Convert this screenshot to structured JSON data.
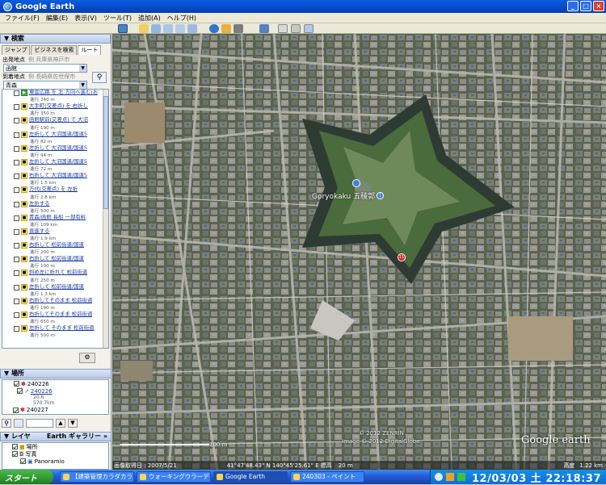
{
  "window": {
    "title": "Google Earth"
  },
  "menu": [
    "ファイル(F)",
    "編集(E)",
    "表示(V)",
    "ツール(T)",
    "追加(A)",
    "ヘルプ(H)"
  ],
  "search_panel": {
    "header": "▼ 検索",
    "tabs": [
      "ジャンプ",
      "ビジネスを検索",
      "ルート"
    ],
    "from_label": "出発地点",
    "from_example": "例  兵庫県神戸市",
    "from_value": "函館",
    "to_label": "到着地点",
    "to_example": "例  長崎県佐世保市",
    "to_value": "青森"
  },
  "route_steps": [
    {
      "text": "東雲広路 を 北 方向へ進む(お",
      "sub": "進行 240 m",
      "start": true
    },
    {
      "text": "大手町(交差点) を 右折し",
      "sub": "進行 350 m"
    },
    {
      "text": "函館駅前(交差点) で 大沼",
      "sub": "進行 190 m"
    },
    {
      "text": "左折して 大沼国道/国道5",
      "sub": "進行 82 m"
    },
    {
      "text": "左折して 大沼国道/国道5",
      "sub": "進行 94 m"
    },
    {
      "text": "左折して 大沼国道/国道5",
      "sub": "進行 72 m"
    },
    {
      "text": "右折して 大沼国道/国道5",
      "sub": "進行 1.5 km"
    },
    {
      "text": "万代(交差点) を 左折",
      "sub": "進行 2.8 km"
    },
    {
      "text": "左折する",
      "sub": "進行 500 m"
    },
    {
      "text": "青森/函館 長船 一部有料",
      "sub": "進行 109 km"
    },
    {
      "text": "直進する",
      "sub": "進行 1.9 km"
    },
    {
      "text": "右折して 松前街道/国道",
      "sub": "進行 200 m"
    },
    {
      "text": "右折して 松前街道/国道",
      "sub": "進行 100 m"
    },
    {
      "text": "斜め左に折れて 松前街道",
      "sub": "進行 250 m"
    },
    {
      "text": "左折して 松前街道/国道",
      "sub": "進行 1.3 km"
    },
    {
      "text": "右折してそのまま 松前街道",
      "sub": "進行 190 m"
    },
    {
      "text": "右折してそのまま 松前街道",
      "sub": "進行 650 m"
    },
    {
      "text": "左折して そのまま 松前街道",
      "sub": "進行 500 m"
    }
  ],
  "places_panel": {
    "header": "▼ 場所",
    "items": [
      {
        "name": "240226"
      },
      {
        "name": "240226",
        "sub1": "20.6",
        "sub2": "570.7km"
      },
      {
        "name": "240227"
      }
    ]
  },
  "layers_panel": {
    "header": "▼ レイヤ",
    "gallery_label": "Earth ギャラリー »",
    "items": [
      "場所",
      "写真",
      "Panoramio"
    ]
  },
  "map": {
    "place_label": "Goryokaku 五稜郭",
    "copyright1": "© 2012 ZENRIN",
    "copyright2": "Image © 2012 DigitalGlobe",
    "logo": "Google earth",
    "status_date": "画像取得日 : 2007/5/21",
    "status_coords": "41°47'48.43\" N  140°45'25.61\" E  標高",
    "status_elev": "20 m",
    "status_alt": "高度",
    "status_altval": "1.22 km",
    "scale_label": "200 m"
  },
  "taskbar": {
    "start": "スタート",
    "items": [
      "【建築管理カラダカラ】",
      "ウォーキングウラーデー",
      "Google Earth",
      "240303 - ペイント"
    ],
    "clock": "12/03/03 土 22:18:37"
  }
}
